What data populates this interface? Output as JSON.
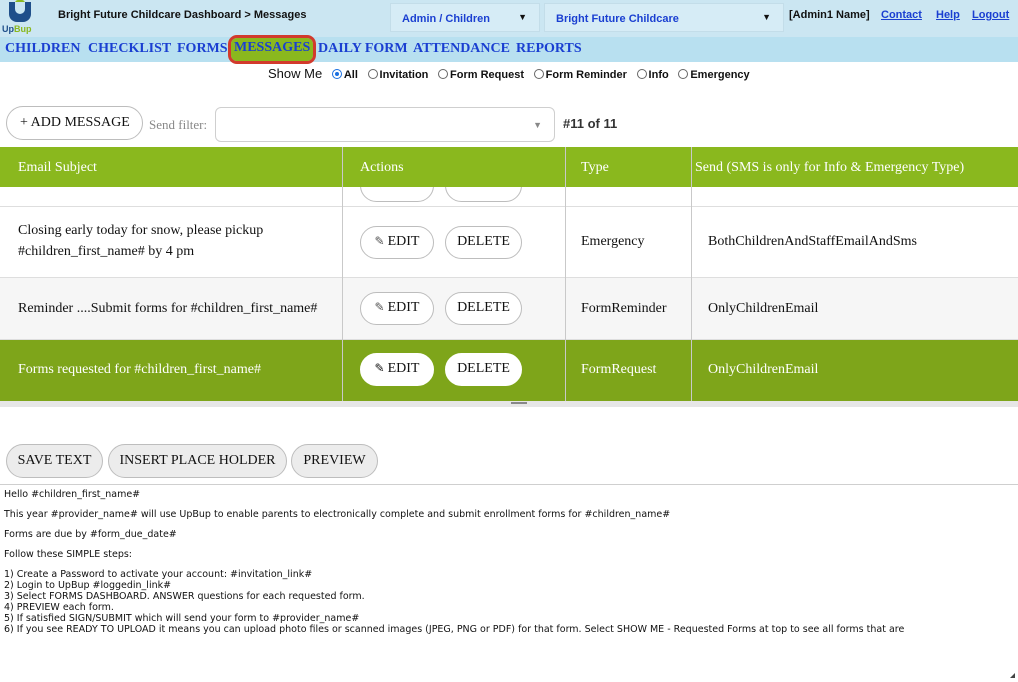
{
  "header": {
    "logo_text_a": "Up",
    "logo_text_b": "Bup",
    "breadcrumb": "Bright Future Childcare Dashboard > Messages",
    "role_select": "Admin / Children",
    "org_select": "Bright Future Childcare",
    "user_name": "[Admin1 Name]",
    "links": [
      "Contact",
      "Help",
      "Logout"
    ]
  },
  "nav": {
    "items": [
      "CHILDREN",
      "CHECKLIST",
      "FORMS",
      "MESSAGES",
      "DAILY FORM",
      "ATTENDANCE",
      "REPORTS"
    ],
    "active": "MESSAGES"
  },
  "filter": {
    "label": "Show Me",
    "options": [
      "All",
      "Invitation",
      "Form Request",
      "Form Reminder",
      "Info",
      "Emergency"
    ],
    "selected": "All"
  },
  "toolbar": {
    "add_label": "+ ADD MESSAGE",
    "send_filter_label": "Send filter:",
    "send_filter_value": "",
    "count": "#11 of 11"
  },
  "table": {
    "columns": [
      "Email Subject",
      "Actions",
      "Type",
      "Send (SMS is only for Info & Emergency Type)"
    ],
    "edit_label": "EDIT",
    "delete_label": "DELETE",
    "rows": [
      {
        "subject_line1": "Closing early today for snow, please pickup",
        "subject_line2": "#children_first_name# by 4 pm",
        "type": "Emergency",
        "send": "BothChildrenAndStaffEmailAndSms"
      },
      {
        "subject_line1": "Reminder ....Submit forms for #children_first_name#",
        "subject_line2": "",
        "type": "FormReminder",
        "send": "OnlyChildrenEmail"
      },
      {
        "subject_line1": "Forms requested for #children_first_name#",
        "subject_line2": "",
        "type": "FormRequest",
        "send": "OnlyChildrenEmail"
      }
    ]
  },
  "editor": {
    "buttons": [
      "SAVE TEXT",
      "INSERT PLACE HOLDER",
      "PREVIEW"
    ],
    "lines": [
      "Hello #children_first_name#",
      "This year #provider_name# will use UpBup to enable parents to electronically complete and submit enrollment forms for #children_name#",
      "Forms are due by #form_due_date#",
      "Follow these SIMPLE steps:",
      "1) Create a Password to activate your account: #invitation_link#",
      "2) Login to UpBup #loggedin_link#",
      "3) Select FORMS DASHBOARD. ANSWER questions for each requested form.",
      "4) PREVIEW each form.",
      "5) If satisfied SIGN/SUBMIT which will send your form to #provider_name#",
      "6) If you see READY TO UPLOAD it means you can upload photo files or scanned images (JPEG, PNG or PDF) for that form. Select SHOW ME - Requested Forms at top to see all forms that are"
    ]
  },
  "colors": {
    "header_bg": "#cbe6f2",
    "nav_bg": "#b8e0f0",
    "accent_green": "#8ab81e",
    "link_blue": "#1a3fd1",
    "highlight_red": "#d23a2c"
  }
}
